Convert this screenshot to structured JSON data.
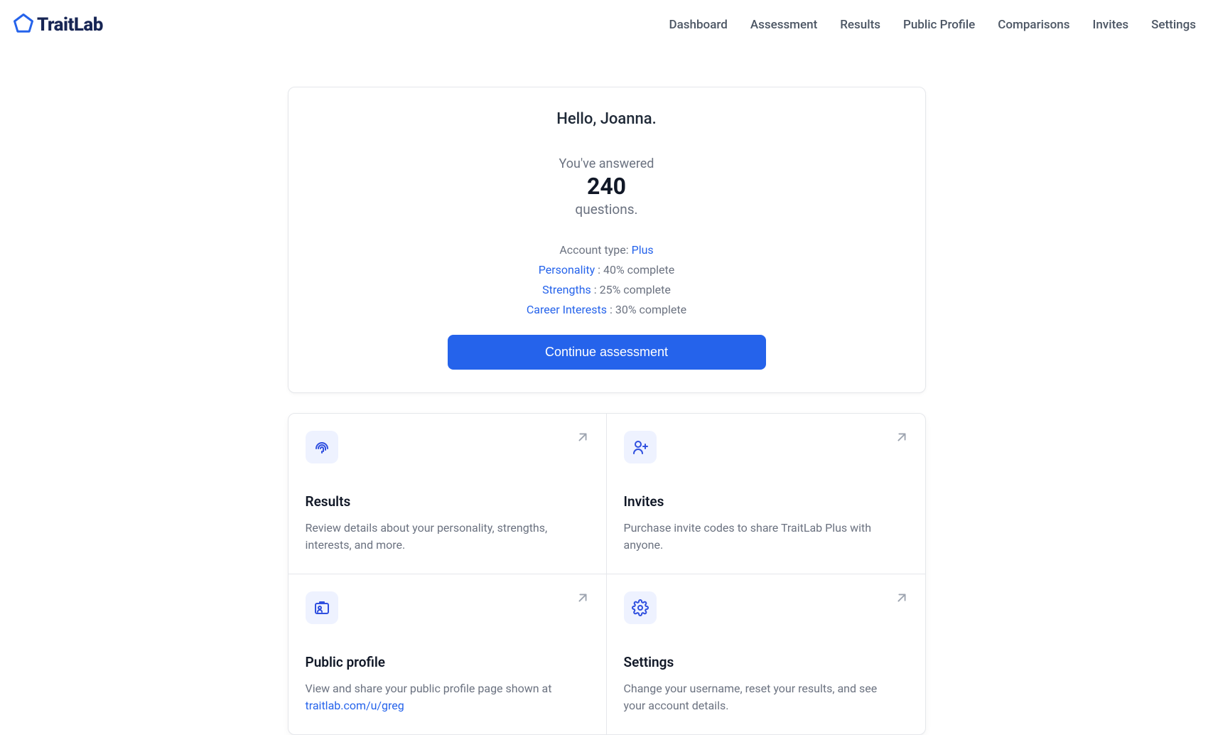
{
  "brand": {
    "name": "TraitLab"
  },
  "nav": {
    "dashboard": "Dashboard",
    "assessment": "Assessment",
    "results": "Results",
    "public_profile": "Public Profile",
    "comparisons": "Comparisons",
    "invites": "Invites",
    "settings": "Settings"
  },
  "hero": {
    "greeting": "Hello, Joanna.",
    "answered_label": "You've answered",
    "answered_count": "240",
    "answered_suffix": "questions.",
    "account_type_label": "Account type: ",
    "account_type_value": "Plus",
    "progress": {
      "personality": {
        "label": "Personality",
        "suffix": " : 40% complete"
      },
      "strengths": {
        "label": "Strengths",
        "suffix": " : 25% complete"
      },
      "interests": {
        "label": "Career Interests",
        "suffix": " : 30% complete"
      }
    },
    "cta": "Continue assessment"
  },
  "cards": {
    "results": {
      "title": "Results",
      "desc": "Review details about your personality, strengths, interests, and more."
    },
    "invites": {
      "title": "Invites",
      "desc": "Purchase invite codes to share TraitLab Plus with anyone."
    },
    "public_profile": {
      "title": "Public profile",
      "desc_prefix": "View and share your public profile page shown at ",
      "desc_link": "traitlab.com/u/greg"
    },
    "settings": {
      "title": "Settings",
      "desc": "Change your username, reset your results, and see your account details."
    }
  }
}
